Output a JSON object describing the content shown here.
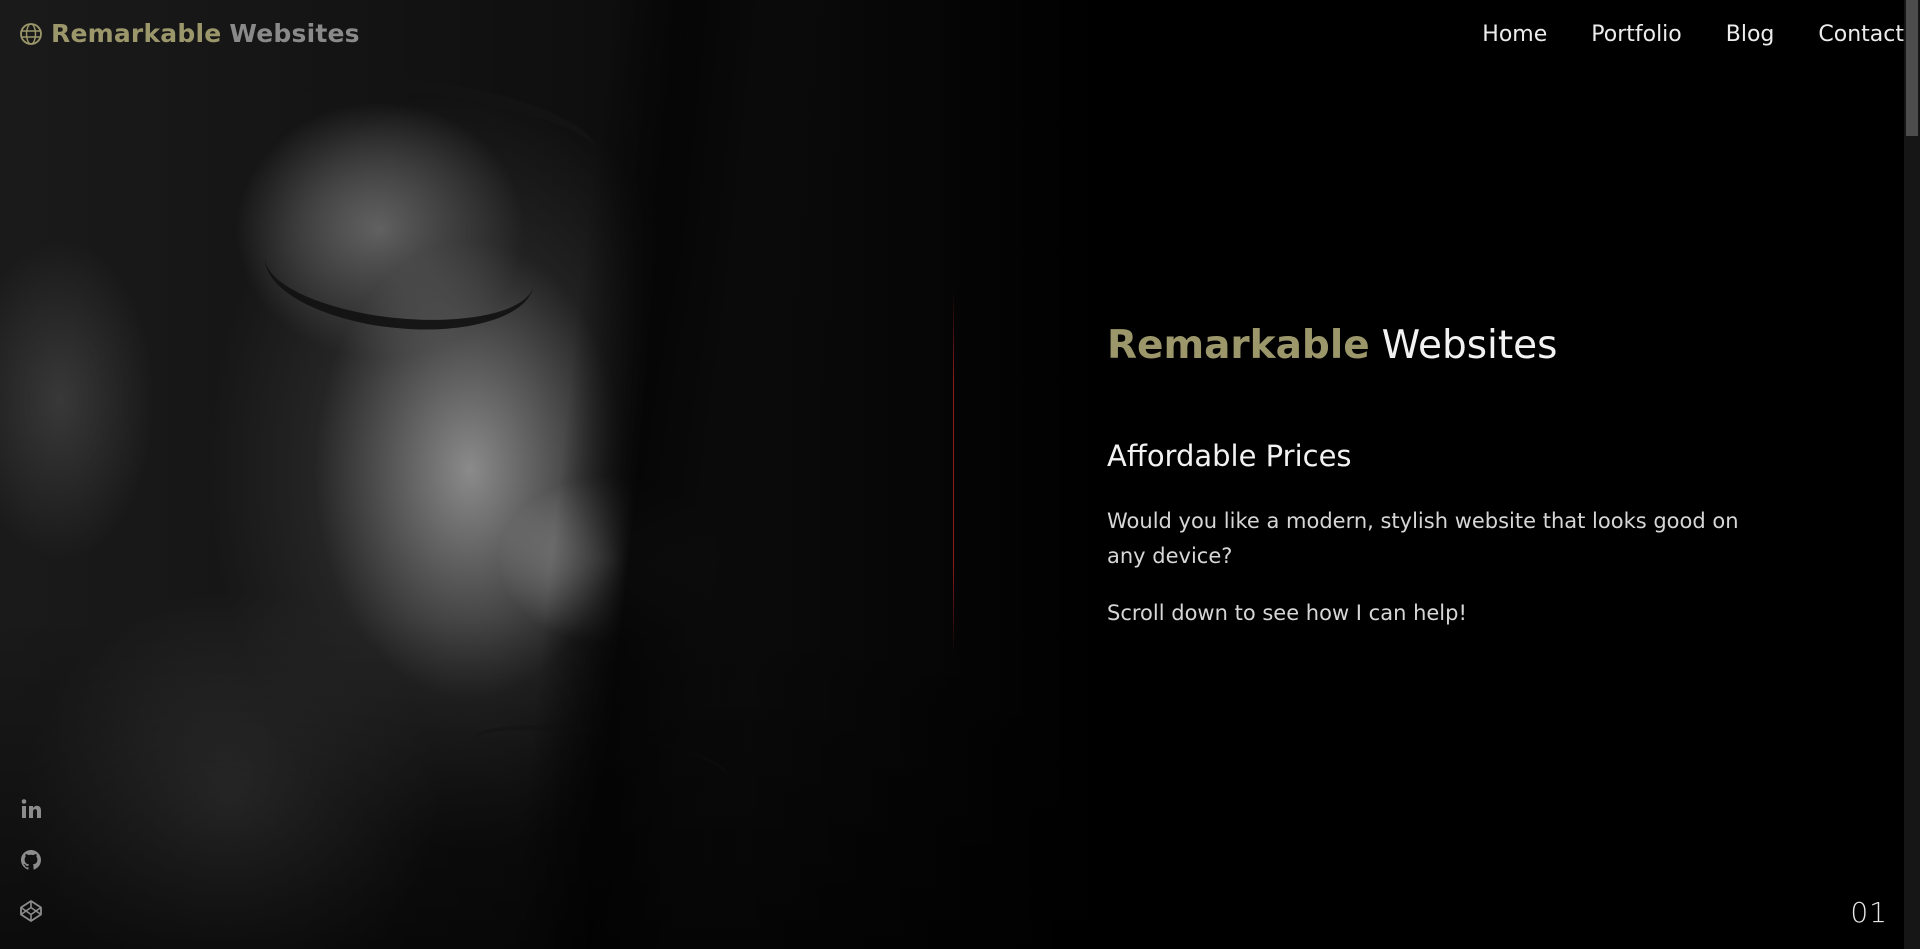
{
  "header": {
    "logo": {
      "brand_strong": "Remarkable",
      "brand_light": "Websites",
      "icon": "globe-icon"
    },
    "nav": [
      {
        "label": "Home"
      },
      {
        "label": "Portfolio"
      },
      {
        "label": "Blog"
      },
      {
        "label": "Contact"
      }
    ]
  },
  "hero": {
    "image": "woman-portrait-photo",
    "headline_strong": "Remarkable",
    "headline_light": "Websites",
    "subheading": "Affordable Prices",
    "paragraphs": [
      "Would you like a modern, stylish website that looks good on any device?",
      "Scroll down to see how I can help!"
    ]
  },
  "social": [
    {
      "name": "linkedin",
      "icon": "linkedin-icon"
    },
    {
      "name": "github",
      "icon": "github-icon"
    },
    {
      "name": "codepen",
      "icon": "codepen-icon"
    }
  ],
  "slide_counter": "01",
  "colors": {
    "accent": "#9b976b",
    "text": "#f2f2f2",
    "divider": "#8c1c1c",
    "background": "#000000"
  }
}
